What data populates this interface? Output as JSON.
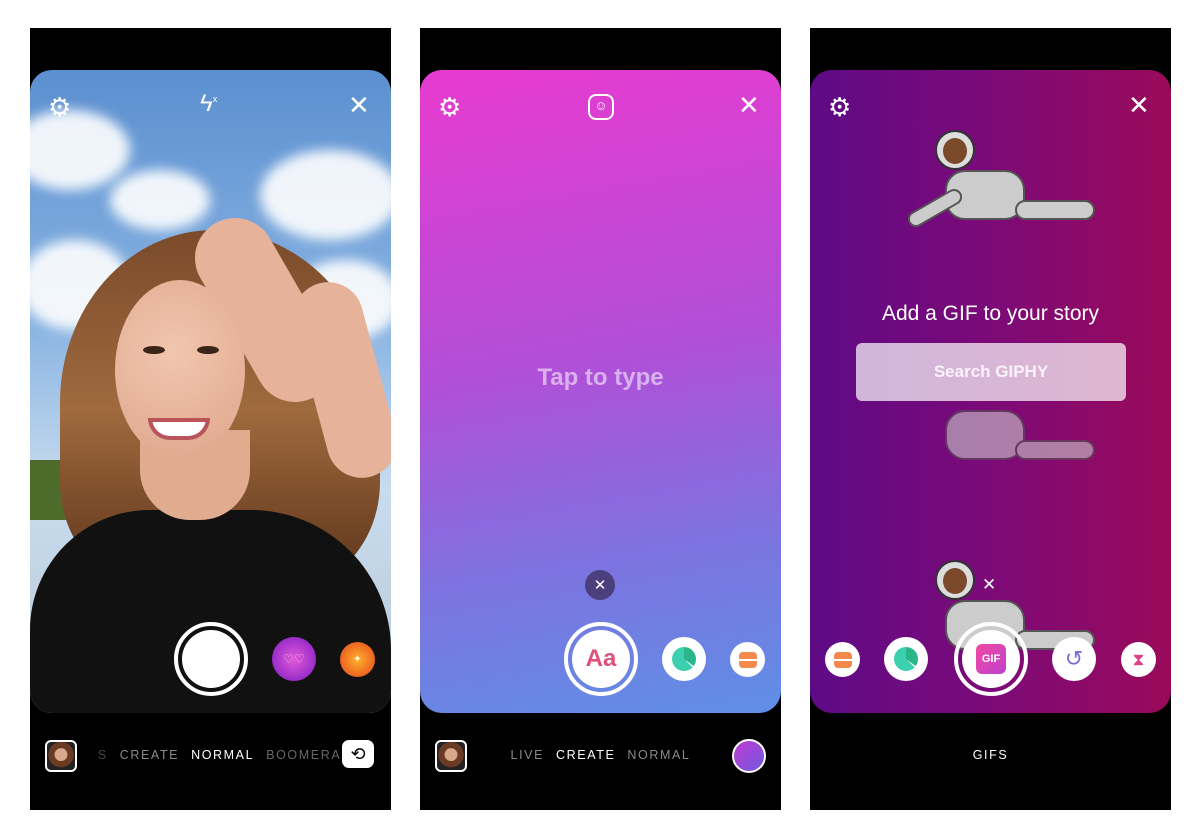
{
  "panels": [
    {
      "modes": [
        "S",
        "CREATE",
        "NORMAL",
        "BOOMERANG"
      ],
      "active_mode": "NORMAL"
    },
    {
      "modes": [
        "LIVE",
        "CREATE",
        "NORMAL"
      ],
      "active_mode": "CREATE",
      "placeholder": "Tap to type",
      "text_button": "Aa"
    },
    {
      "mode": "GIFS",
      "title": "Add a GIF to your story",
      "search_placeholder": "Search GIPHY",
      "gif_button": "GIF"
    }
  ],
  "icons": {
    "settings": "gear-icon",
    "flash": "flash-off-icon",
    "close": "close-icon",
    "sticker": "sticker-icon",
    "flip": "flip-camera-icon",
    "poll": "poll-icon",
    "quiz": "quiz-icon",
    "history": "history-icon",
    "countdown": "hourglass-icon"
  },
  "colors": {
    "create_gradient_top": "#e63ad0",
    "create_gradient_bottom": "#5f8fe6",
    "gif_bg_left": "#6a0a8a",
    "gif_bg_right": "#9a0a5a"
  }
}
